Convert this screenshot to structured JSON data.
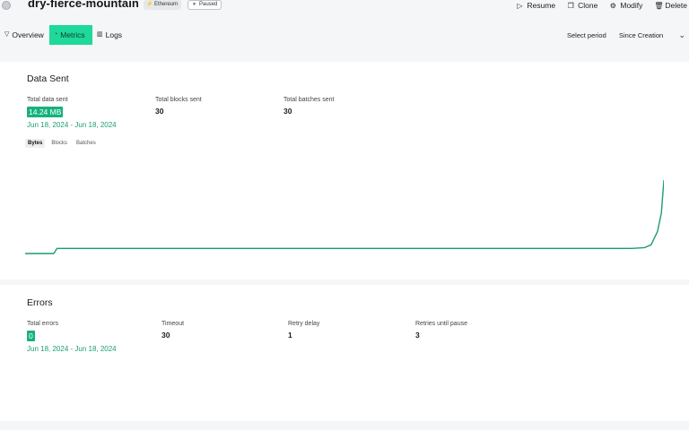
{
  "header": {
    "title": "dry-fierce-mountain",
    "network_badge": "Ethereum",
    "status_badge": "Paused",
    "actions": [
      {
        "label": "Resume",
        "icon": "play-icon"
      },
      {
        "label": "Clone",
        "icon": "copy-icon"
      },
      {
        "label": "Modify",
        "icon": "gear-icon"
      },
      {
        "label": "Delete",
        "icon": "trash-icon"
      }
    ]
  },
  "tabs": [
    {
      "label": "Overview",
      "icon": "filter-icon"
    },
    {
      "label": "Metrics",
      "icon": "gauge-icon",
      "active": true
    },
    {
      "label": "Logs",
      "icon": "book-icon"
    }
  ],
  "period": {
    "label": "Select period",
    "value": "Since Creation"
  },
  "data_sent": {
    "heading": "Data Sent",
    "stats": [
      {
        "label": "Total data sent",
        "value": "14.24 MB"
      },
      {
        "label": "Total blocks sent",
        "value": "30"
      },
      {
        "label": "Total batches sent",
        "value": "30"
      }
    ],
    "date_range": "Jun 18, 2024 - Jun 18, 2024",
    "units": [
      "Bytes",
      "Blocks",
      "Batches"
    ],
    "active_unit": "Bytes"
  },
  "errors": {
    "heading": "Errors",
    "stats": [
      {
        "label": "Total errors",
        "value": "0"
      },
      {
        "label": "Timeout",
        "value": "30"
      },
      {
        "label": "Retry delay",
        "value": "1"
      },
      {
        "label": "Retries until pause",
        "value": "3"
      }
    ],
    "date_range": "Jun 18, 2024 - Jun 18, 2024"
  },
  "chart_data": {
    "type": "line",
    "x": [
      0,
      4.5,
      5,
      95,
      97,
      98,
      99,
      99.6,
      100
    ],
    "y": [
      0,
      0,
      7,
      7,
      8,
      12,
      30,
      55,
      100
    ],
    "title": "",
    "xlabel": "",
    "ylabel": "",
    "xlim": [
      0,
      100
    ],
    "ylim": [
      0,
      100
    ],
    "grid": false,
    "color": "#1c9e6a"
  }
}
